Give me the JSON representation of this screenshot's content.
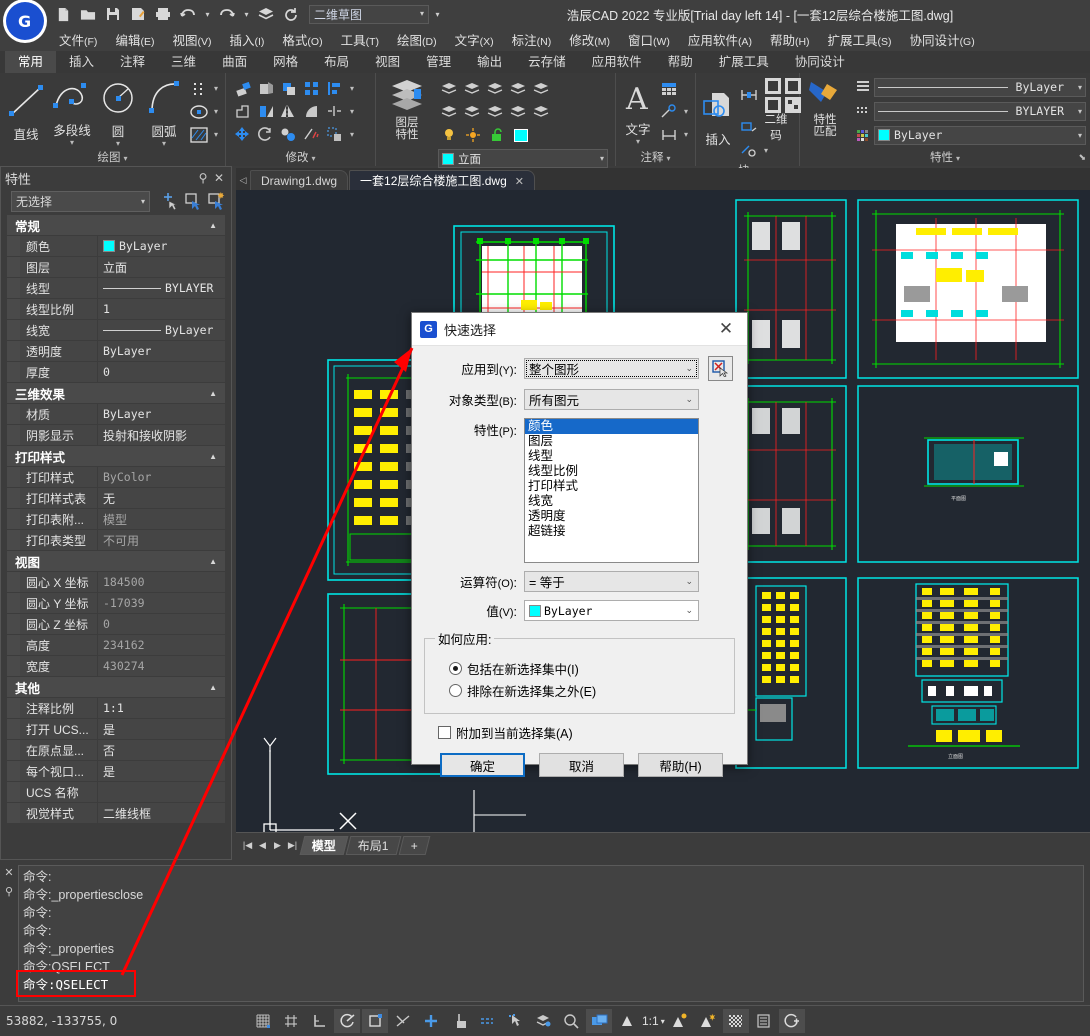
{
  "window": {
    "title": "浩辰CAD 2022 专业版[Trial day left 14] - [一套12层综合楼施工图.dwg]",
    "workspace": "二维草图",
    "logo_text": "G"
  },
  "quick_access": [
    {
      "name": "new-file-icon",
      "label": "新建"
    },
    {
      "name": "open-file-icon",
      "label": "打开"
    },
    {
      "name": "save-icon",
      "label": "保存"
    },
    {
      "name": "save-as-icon",
      "label": "另存为"
    },
    {
      "name": "print-icon",
      "label": "打印"
    },
    {
      "name": "undo-icon",
      "label": "撤销"
    },
    {
      "name": "redo-icon",
      "label": "重做"
    },
    {
      "name": "layers-icon",
      "label": "图层"
    },
    {
      "name": "refresh-icon",
      "label": "重生成"
    }
  ],
  "menubar": [
    {
      "label": "文件",
      "mnemonic": "(F)"
    },
    {
      "label": "编辑",
      "mnemonic": "(E)"
    },
    {
      "label": "视图",
      "mnemonic": "(V)"
    },
    {
      "label": "插入",
      "mnemonic": "(I)"
    },
    {
      "label": "格式",
      "mnemonic": "(O)"
    },
    {
      "label": "工具",
      "mnemonic": "(T)"
    },
    {
      "label": "绘图",
      "mnemonic": "(D)"
    },
    {
      "label": "文字",
      "mnemonic": "(X)"
    },
    {
      "label": "标注",
      "mnemonic": "(N)"
    },
    {
      "label": "修改",
      "mnemonic": "(M)"
    },
    {
      "label": "窗口",
      "mnemonic": "(W)"
    },
    {
      "label": "应用软件",
      "mnemonic": "(A)"
    },
    {
      "label": "帮助",
      "mnemonic": "(H)"
    },
    {
      "label": "扩展工具",
      "mnemonic": "(S)"
    },
    {
      "label": "协同设计",
      "mnemonic": "(G)"
    }
  ],
  "ribbon_tabs": [
    {
      "label": "常用",
      "active": true
    },
    {
      "label": "插入",
      "active": false
    },
    {
      "label": "注释",
      "active": false
    },
    {
      "label": "三维",
      "active": false
    },
    {
      "label": "曲面",
      "active": false
    },
    {
      "label": "网格",
      "active": false
    },
    {
      "label": "布局",
      "active": false
    },
    {
      "label": "视图",
      "active": false
    },
    {
      "label": "管理",
      "active": false
    },
    {
      "label": "输出",
      "active": false
    },
    {
      "label": "云存储",
      "active": false
    },
    {
      "label": "应用软件",
      "active": false
    },
    {
      "label": "帮助",
      "active": false
    },
    {
      "label": "扩展工具",
      "active": false
    },
    {
      "label": "协同设计",
      "active": false
    }
  ],
  "ribbon_panels": {
    "draw": {
      "title": "绘图",
      "buttons": [
        {
          "label": "直线",
          "icon": "line-icon"
        },
        {
          "label": "多段线",
          "icon": "polyline-icon"
        },
        {
          "label": "圆",
          "icon": "circle-icon"
        },
        {
          "label": "圆弧",
          "icon": "arc-icon"
        }
      ],
      "small_icons": [
        "point-icon",
        "ellipse-icon",
        "hatch-icon"
      ]
    },
    "modify": {
      "title": "修改",
      "small_icons": [
        "erase-icon",
        "copy-icon",
        "offset-icon",
        "array-icon",
        "align-icon",
        "extrude-icon",
        "stretch-icon",
        "mirror-icon",
        "fillet-icon",
        "break-icon",
        "move-icon",
        "rotate-icon",
        "scale-icon",
        "trim-icon",
        "explode-icon"
      ]
    },
    "layer": {
      "title": "图层",
      "button_label": "图层\n特性",
      "current_layer": "立面",
      "layer_color": "#00ffff"
    },
    "annotation": {
      "title": "注释",
      "button_label": "文字",
      "small_icons": [
        "table-icon",
        "leader-icon",
        "dimension-icon"
      ]
    },
    "block": {
      "title": "块",
      "button_label": "插入",
      "qrcode_label": "二维码",
      "small_icons": [
        "block-edit-icon",
        "define-attribute-icon",
        "edit-attribute-icon"
      ]
    },
    "properties": {
      "title": "特性",
      "button_label": "特性\n匹配",
      "color_value": "ByLayer",
      "linetype_value": "BYLAYER",
      "lineweight_value": "ByLayer",
      "color_swatch": "#00ffff"
    }
  },
  "properties_palette": {
    "title": "特性",
    "selection": "无选择",
    "tool_icons": [
      "select-object-icon",
      "quick-select-icon",
      "pickadd-icon"
    ],
    "groups": [
      {
        "name": "常规",
        "rows": [
          {
            "key": "颜色",
            "value": "ByLayer",
            "swatch": "#00ffff",
            "dim": false
          },
          {
            "key": "图层",
            "value": "立面",
            "cjk": true,
            "dim": false
          },
          {
            "key": "线型",
            "value": "BYLAYER",
            "line": true,
            "dim": false
          },
          {
            "key": "线型比例",
            "value": "1",
            "dim": false
          },
          {
            "key": "线宽",
            "value": "ByLayer",
            "line": true,
            "dim": false
          },
          {
            "key": "透明度",
            "value": "ByLayer",
            "dim": false
          },
          {
            "key": "厚度",
            "value": "0",
            "dim": false
          }
        ]
      },
      {
        "name": "三维效果",
        "rows": [
          {
            "key": "材质",
            "value": "ByLayer",
            "dim": false
          },
          {
            "key": "阴影显示",
            "value": "投射和接收阴影",
            "cjk": true,
            "dim": false
          }
        ]
      },
      {
        "name": "打印样式",
        "rows": [
          {
            "key": "打印样式",
            "value": "ByColor",
            "dim": true
          },
          {
            "key": "打印样式表",
            "value": "无",
            "cjk": true,
            "dim": false
          },
          {
            "key": "打印表附...",
            "value": "模型",
            "cjk": true,
            "dim": true
          },
          {
            "key": "打印表类型",
            "value": "不可用",
            "cjk": true,
            "dim": true
          }
        ]
      },
      {
        "name": "视图",
        "rows": [
          {
            "key": "圆心 X 坐标",
            "value": "184500",
            "dim": true
          },
          {
            "key": "圆心 Y 坐标",
            "value": "-17039",
            "dim": true
          },
          {
            "key": "圆心 Z 坐标",
            "value": "0",
            "dim": true
          },
          {
            "key": "高度",
            "value": "234162",
            "dim": true
          },
          {
            "key": "宽度",
            "value": "430274",
            "dim": true
          }
        ]
      },
      {
        "name": "其他",
        "rows": [
          {
            "key": "注释比例",
            "value": "1:1",
            "dim": false
          },
          {
            "key": "打开 UCS...",
            "value": "是",
            "cjk": true,
            "dim": false
          },
          {
            "key": "在原点显...",
            "value": "否",
            "cjk": true,
            "dim": false
          },
          {
            "key": "每个视口...",
            "value": "是",
            "cjk": true,
            "dim": false
          },
          {
            "key": "UCS 名称",
            "value": "",
            "dim": false
          },
          {
            "key": "视觉样式",
            "value": "二维线框",
            "cjk": true,
            "dim": false
          }
        ]
      }
    ]
  },
  "file_tabs": [
    {
      "label": "Drawing1.dwg",
      "active": false,
      "closable": false
    },
    {
      "label": "一套12层综合楼施工图.dwg",
      "active": true,
      "closable": true
    }
  ],
  "model_tabs": [
    {
      "label": "模型",
      "active": true
    },
    {
      "label": "布局1",
      "active": false
    },
    {
      "label": "+",
      "active": false
    }
  ],
  "dialog": {
    "title": "快速选择",
    "logo_text": "G",
    "close_label": "✕",
    "apply_to": {
      "label": "应用到",
      "mnemonic": "(Y)",
      "value": "整个图形"
    },
    "object_type": {
      "label": "对象类型",
      "mnemonic": "(B)",
      "value": "所有图元"
    },
    "properties": {
      "label": "特性",
      "mnemonic": "(P)",
      "items": [
        "颜色",
        "图层",
        "线型",
        "线型比例",
        "打印样式",
        "线宽",
        "透明度",
        "超链接"
      ],
      "selected_index": 0
    },
    "operator": {
      "label": "运算符",
      "mnemonic": "(O)",
      "value": "= 等于"
    },
    "value": {
      "label": "值",
      "mnemonic": "(V)",
      "value": "ByLayer",
      "swatch": "#00ffff"
    },
    "how_to_apply": {
      "legend": "如何应用:",
      "options": [
        {
          "label": "包括在新选择集中",
          "mnemonic": "(I)",
          "checked": true
        },
        {
          "label": "排除在新选择集之外",
          "mnemonic": "(E)",
          "checked": false
        }
      ]
    },
    "append": {
      "label": "附加到当前选择集",
      "mnemonic": "(A)",
      "checked": false
    },
    "buttons": [
      {
        "label": "确定",
        "primary": true
      },
      {
        "label": "取消",
        "primary": false
      },
      {
        "label": "帮助(H)",
        "primary": false
      }
    ]
  },
  "command_line": {
    "history": [
      "命令:",
      "命令:_propertiesclose",
      "命令:",
      "命令:",
      "命令:_properties",
      "命令:QSELECT"
    ],
    "current": "命令:QSELECT"
  },
  "status_bar": {
    "coordinates": "53882, -133755, 0",
    "scale": "1:1",
    "toggles": [
      {
        "name": "snap-grid-icon",
        "on": false
      },
      {
        "name": "grid-display-icon",
        "on": false
      },
      {
        "name": "ortho-icon",
        "on": false
      },
      {
        "name": "polar-tracking-icon",
        "on": true
      },
      {
        "name": "object-snap-icon",
        "on": true
      },
      {
        "name": "osnap-tracking-icon",
        "on": false
      },
      {
        "name": "dynamic-ucs-icon",
        "on": false
      },
      {
        "name": "dynamic-input-icon",
        "on": true
      },
      {
        "name": "lineweight-icon",
        "on": false
      },
      {
        "name": "transparency-icon",
        "on": false
      },
      {
        "name": "quick-properties-icon",
        "on": false
      },
      {
        "name": "selection-cycling-icon",
        "on": false
      },
      {
        "name": "annotation-visibility-icon",
        "on": true
      },
      {
        "name": "annotation-scale-icon",
        "on": false
      },
      {
        "name": "autoscale-icon",
        "on": false
      },
      {
        "name": "workspace-switch-icon",
        "on": false
      },
      {
        "name": "hardware-accel-icon",
        "on": true
      },
      {
        "name": "customize-icon",
        "on": false
      },
      {
        "name": "clean-screen-icon",
        "on": true
      }
    ]
  },
  "annotations": {
    "highlight_box_label": "命令:QSELECT",
    "arrow_color": "#ff0000"
  }
}
